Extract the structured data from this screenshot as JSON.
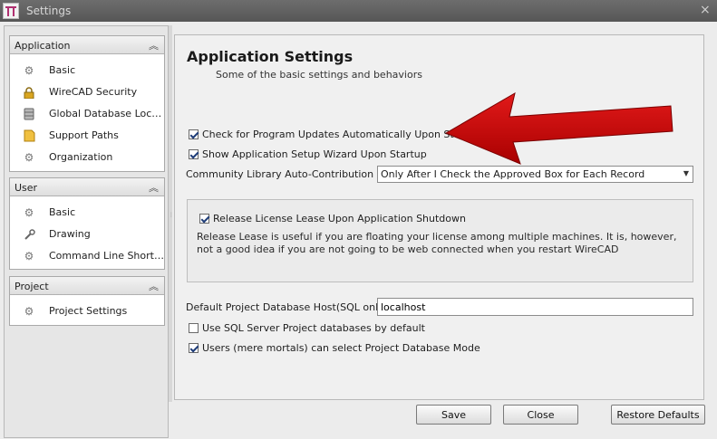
{
  "window": {
    "title": "Settings",
    "close_glyph": "×",
    "app_icon": "wirecad-app-icon"
  },
  "sidebar": {
    "groups": [
      {
        "title": "Application",
        "collapse_glyph": "︽",
        "items": [
          {
            "label": "Basic",
            "icon": "gear-icon"
          },
          {
            "label": "WireCAD Security",
            "icon": "lock-icon"
          },
          {
            "label": "Global Database Loc…",
            "icon": "database-icon"
          },
          {
            "label": "Support Paths",
            "icon": "folder-icon"
          },
          {
            "label": "Organization",
            "icon": "gear-icon"
          }
        ]
      },
      {
        "title": "User",
        "collapse_glyph": "︽",
        "items": [
          {
            "label": "Basic",
            "icon": "gear-icon"
          },
          {
            "label": "Drawing",
            "icon": "wrench-icon"
          },
          {
            "label": "Command Line Short…",
            "icon": "gear-icon"
          }
        ]
      },
      {
        "title": "Project",
        "collapse_glyph": "︽",
        "items": [
          {
            "label": "Project Settings",
            "icon": "gear-icon"
          }
        ]
      }
    ]
  },
  "main": {
    "title": "Application Settings",
    "subtitle": "Some of the basic settings and behaviors",
    "check_updates": {
      "label": "Check for Program Updates Automatically Upon Startup",
      "checked": true
    },
    "show_wizard": {
      "label": "Show Application Setup Wizard Upon Startup",
      "checked": true
    },
    "community_library": {
      "label": "Community Library Auto-Contribution Mode",
      "selected": "Only After I Check the Approved Box for Each Record"
    },
    "release_lease": {
      "label": "Release License Lease Upon Application Shutdown",
      "checked": true,
      "description": "Release Lease is useful if you are floating your license among multiple machines. It is, however, not a good idea if you are not going to be web connected when you restart WireCAD"
    },
    "db_host": {
      "label": "Default Project Database Host(SQL only)",
      "value": "localhost"
    },
    "use_sql_server": {
      "label": "Use SQL Server Project databases by default",
      "checked": false
    },
    "users_select_mode": {
      "label": "Users (mere mortals) can select Project Database Mode",
      "checked": true
    }
  },
  "buttons": {
    "save": "Save",
    "close": "Close",
    "restore": "Restore Defaults"
  },
  "colors": {
    "arrow": "#cc0000",
    "titlebar": "#5e5e5e",
    "check": "#1e3c78"
  }
}
